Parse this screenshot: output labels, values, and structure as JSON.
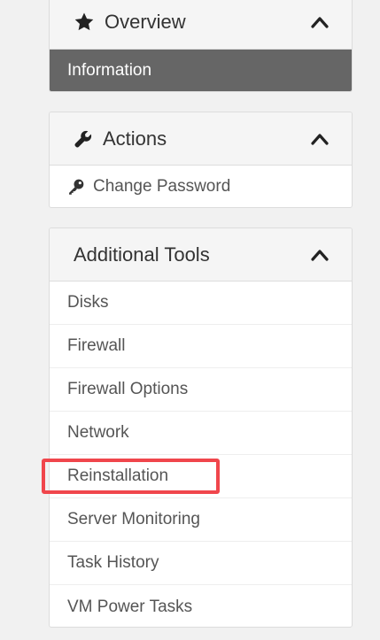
{
  "overview": {
    "title": "Overview",
    "icon": "star-icon",
    "items": [
      {
        "label": "Information",
        "active": true
      }
    ]
  },
  "actions": {
    "title": "Actions",
    "icon": "wrench-icon",
    "items": [
      {
        "label": "Change Password",
        "icon": "key-icon"
      }
    ]
  },
  "additional_tools": {
    "title": "Additional Tools",
    "items": [
      {
        "label": "Disks"
      },
      {
        "label": "Firewall"
      },
      {
        "label": "Firewall Options"
      },
      {
        "label": "Network"
      },
      {
        "label": "Reinstallation",
        "highlighted": true
      },
      {
        "label": "Server Monitoring"
      },
      {
        "label": "Task History"
      },
      {
        "label": "VM Power Tasks"
      }
    ]
  },
  "colors": {
    "active_item_bg": "#666666",
    "highlight_border": "#f0464c",
    "header_bg": "#f5f5f5",
    "page_bg": "#f1f1f1"
  }
}
